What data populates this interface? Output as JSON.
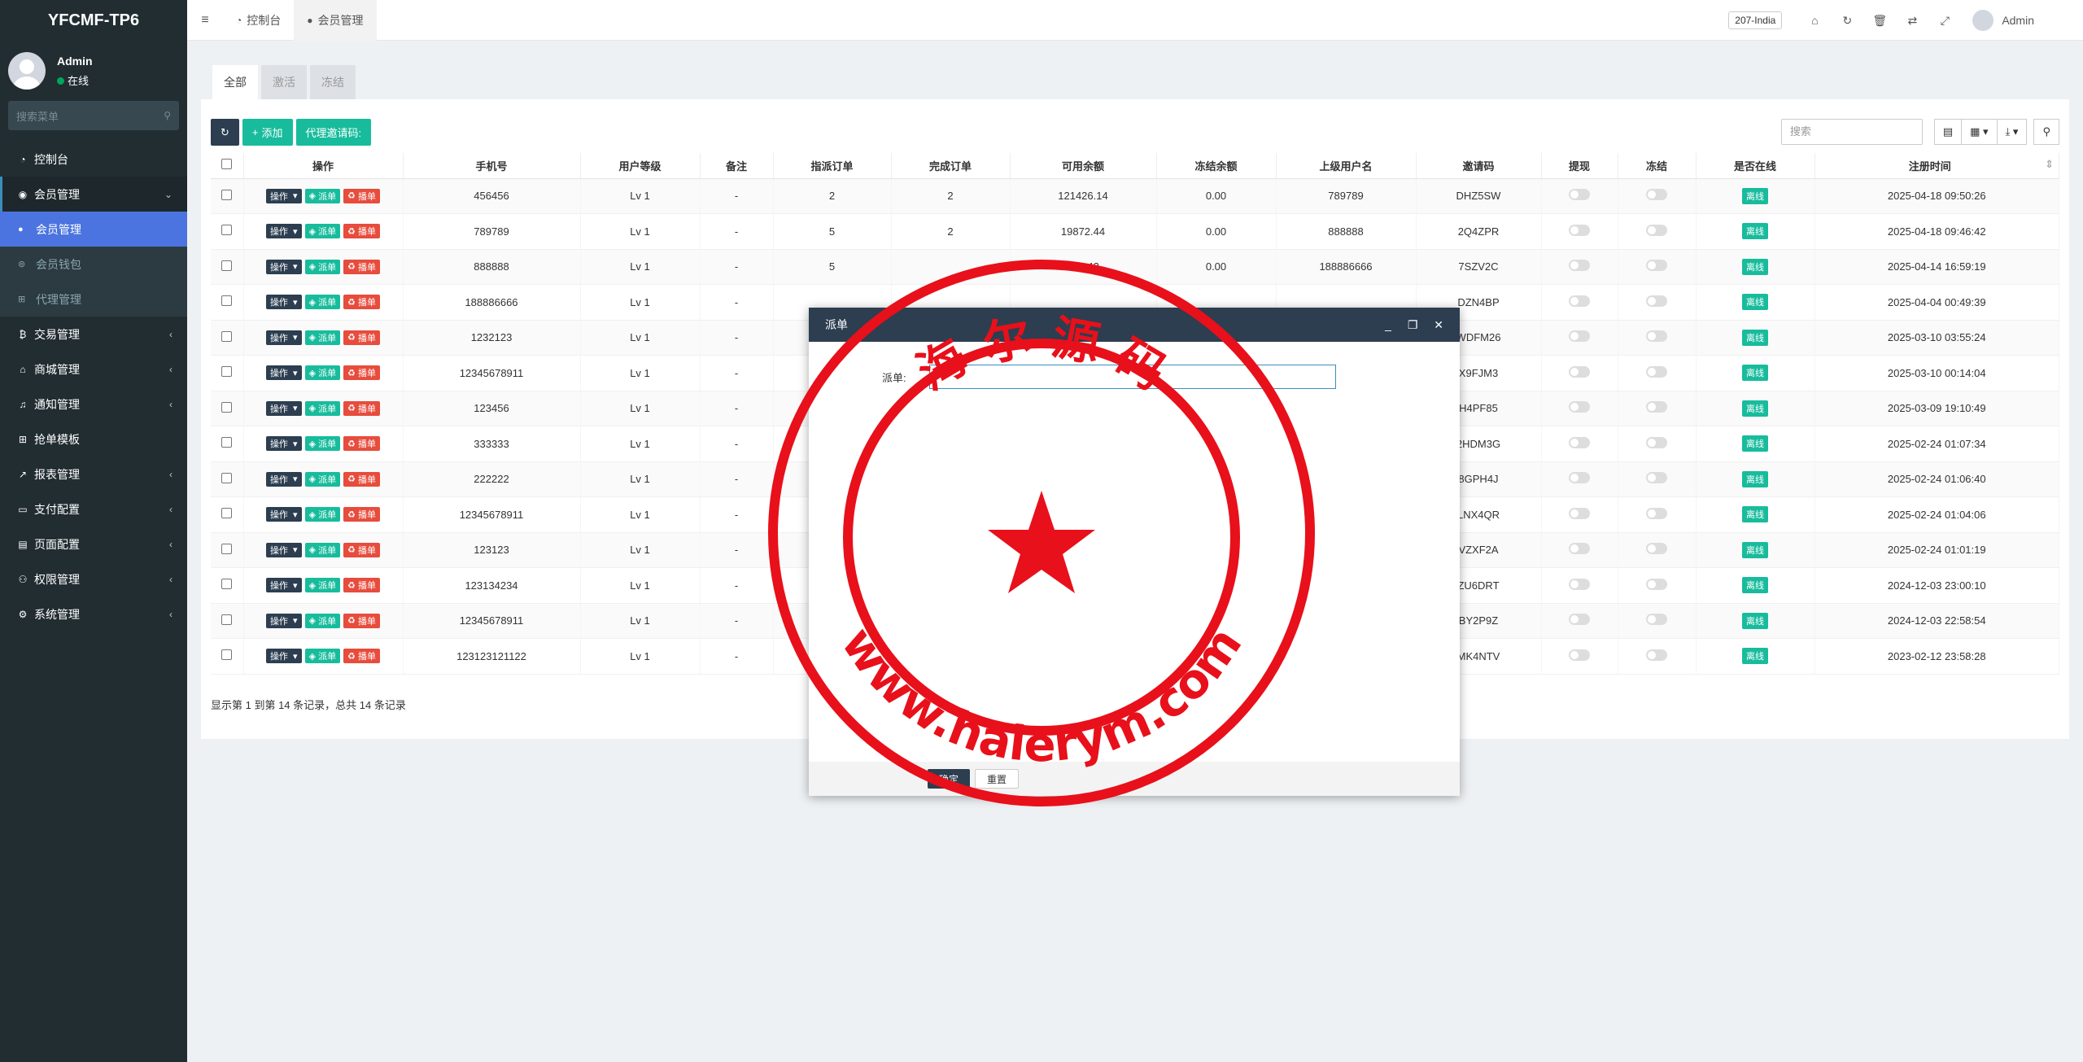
{
  "app": {
    "title": "YFCMF-TP6"
  },
  "user": {
    "name": "Admin",
    "status": "在线"
  },
  "sidebar": {
    "search_placeholder": "搜索菜单",
    "items": [
      {
        "label": "控制台",
        "icon": "dashboard-icon"
      },
      {
        "label": "会员管理",
        "icon": "user-circle-icon",
        "open": true,
        "children": [
          {
            "label": "会员管理",
            "active": true
          },
          {
            "label": "会员钱包"
          },
          {
            "label": "代理管理"
          }
        ]
      },
      {
        "label": "交易管理",
        "icon": "bitcoin-icon"
      },
      {
        "label": "商城管理",
        "icon": "home-icon"
      },
      {
        "label": "通知管理",
        "icon": "bell-icon"
      },
      {
        "label": "抢单模板",
        "icon": "sitemap-icon"
      },
      {
        "label": "报表管理",
        "icon": "chart-icon"
      },
      {
        "label": "支付配置",
        "icon": "credit-card-icon"
      },
      {
        "label": "页面配置",
        "icon": "file-icon"
      },
      {
        "label": "权限管理",
        "icon": "group-icon"
      },
      {
        "label": "系统管理",
        "icon": "cogs-icon"
      }
    ]
  },
  "topbar": {
    "tabs": [
      {
        "label": "控制台"
      },
      {
        "label": "会员管理"
      }
    ],
    "country": "207-India",
    "admin": "Admin"
  },
  "content": {
    "tabs": [
      "全部",
      "激活",
      "冻结"
    ],
    "toolbar": {
      "add": "添加",
      "invite": "代理邀请码:"
    },
    "search_placeholder": "搜索",
    "columns": [
      "操作",
      "手机号",
      "用户等级",
      "备注",
      "指派订单",
      "完成订单",
      "可用余额",
      "冻结余额",
      "上级用户名",
      "邀请码",
      "提现",
      "冻结",
      "是否在线",
      "注册时间"
    ],
    "op_labels": {
      "action": "操作",
      "dispatch": "派单",
      "grab": "播单"
    },
    "rows": [
      {
        "phone": "456456",
        "level": "Lv 1",
        "note": "-",
        "assigned": "2",
        "done": "2",
        "balance": "121426.14",
        "frozen": "0.00",
        "parent": "789789",
        "code": "DHZ5SW",
        "online": "离线",
        "time": "2025-04-18 09:50:26"
      },
      {
        "phone": "789789",
        "level": "Lv 1",
        "note": "-",
        "assigned": "5",
        "done": "2",
        "balance": "19872.44",
        "frozen": "0.00",
        "parent": "888888",
        "code": "2Q4ZPR",
        "online": "离线",
        "time": "2025-04-18 09:46:42"
      },
      {
        "phone": "888888",
        "level": "Lv 1",
        "note": "-",
        "assigned": "5",
        "done": "",
        "balance": "971.42",
        "frozen": "0.00",
        "parent": "188886666",
        "code": "7SZV2C",
        "online": "离线",
        "time": "2025-04-14 16:59:19"
      },
      {
        "phone": "188886666",
        "level": "Lv 1",
        "note": "-",
        "assigned": "",
        "done": "",
        "balance": "",
        "frozen": "",
        "parent": "",
        "code": "DZN4BP",
        "online": "离线",
        "time": "2025-04-04 00:49:39"
      },
      {
        "phone": "1232123",
        "level": "Lv 1",
        "note": "-",
        "assigned": "",
        "done": "",
        "balance": "",
        "frozen": "",
        "parent": "",
        "code": "WDFM26",
        "online": "离线",
        "time": "2025-03-10 03:55:24"
      },
      {
        "phone": "12345678911",
        "level": "Lv 1",
        "note": "-",
        "assigned": "",
        "done": "",
        "balance": "",
        "frozen": "",
        "parent": "",
        "code": "X9FJM3",
        "online": "离线",
        "time": "2025-03-10 00:14:04"
      },
      {
        "phone": "123456",
        "level": "Lv 1",
        "note": "-",
        "assigned": "",
        "done": "",
        "balance": "",
        "frozen": "",
        "parent": "",
        "code": "H4PF85",
        "online": "离线",
        "time": "2025-03-09 19:10:49"
      },
      {
        "phone": "333333",
        "level": "Lv 1",
        "note": "-",
        "assigned": "",
        "done": "",
        "balance": "",
        "frozen": "",
        "parent": "",
        "code": "2HDM3G",
        "online": "离线",
        "time": "2025-02-24 01:07:34"
      },
      {
        "phone": "222222",
        "level": "Lv 1",
        "note": "-",
        "assigned": "",
        "done": "",
        "balance": "",
        "frozen": "",
        "parent": "",
        "code": "8GPH4J",
        "online": "离线",
        "time": "2025-02-24 01:06:40"
      },
      {
        "phone": "12345678911",
        "level": "Lv 1",
        "note": "-",
        "assigned": "",
        "done": "",
        "balance": "",
        "frozen": "",
        "parent": "",
        "code": "LNX4QR",
        "online": "离线",
        "time": "2025-02-24 01:04:06"
      },
      {
        "phone": "123123",
        "level": "Lv 1",
        "note": "-",
        "assigned": "",
        "done": "",
        "balance": "",
        "frozen": "",
        "parent": "",
        "code": "VZXF2A",
        "online": "离线",
        "time": "2025-02-24 01:01:19"
      },
      {
        "phone": "123134234",
        "level": "Lv 1",
        "note": "-",
        "assigned": "",
        "done": "",
        "balance": "",
        "frozen": "",
        "parent": "",
        "code": "ZU6DRT",
        "online": "离线",
        "time": "2024-12-03 23:00:10"
      },
      {
        "phone": "12345678911",
        "level": "Lv 1",
        "note": "-",
        "assigned": "",
        "done": "",
        "balance": "",
        "frozen": "",
        "parent": "",
        "code": "BY2P9Z",
        "online": "离线",
        "time": "2024-12-03 22:58:54"
      },
      {
        "phone": "123123121122",
        "level": "Lv 1",
        "note": "-",
        "assigned": "",
        "done": "",
        "balance": "",
        "frozen": "",
        "parent": "",
        "code": "MK4NTV",
        "online": "离线",
        "time": "2023-02-12 23:58:28"
      }
    ],
    "pager": "显示第 1 到第 14 条记录，总共 14 条记录"
  },
  "modal": {
    "title": "派单",
    "field_label": "派单:",
    "confirm": "确定",
    "reset": "重置"
  },
  "watermark": {
    "top_text": "海 尔 源 码",
    "bottom_text": "www.haierym.com",
    "color": "#e8101a"
  }
}
